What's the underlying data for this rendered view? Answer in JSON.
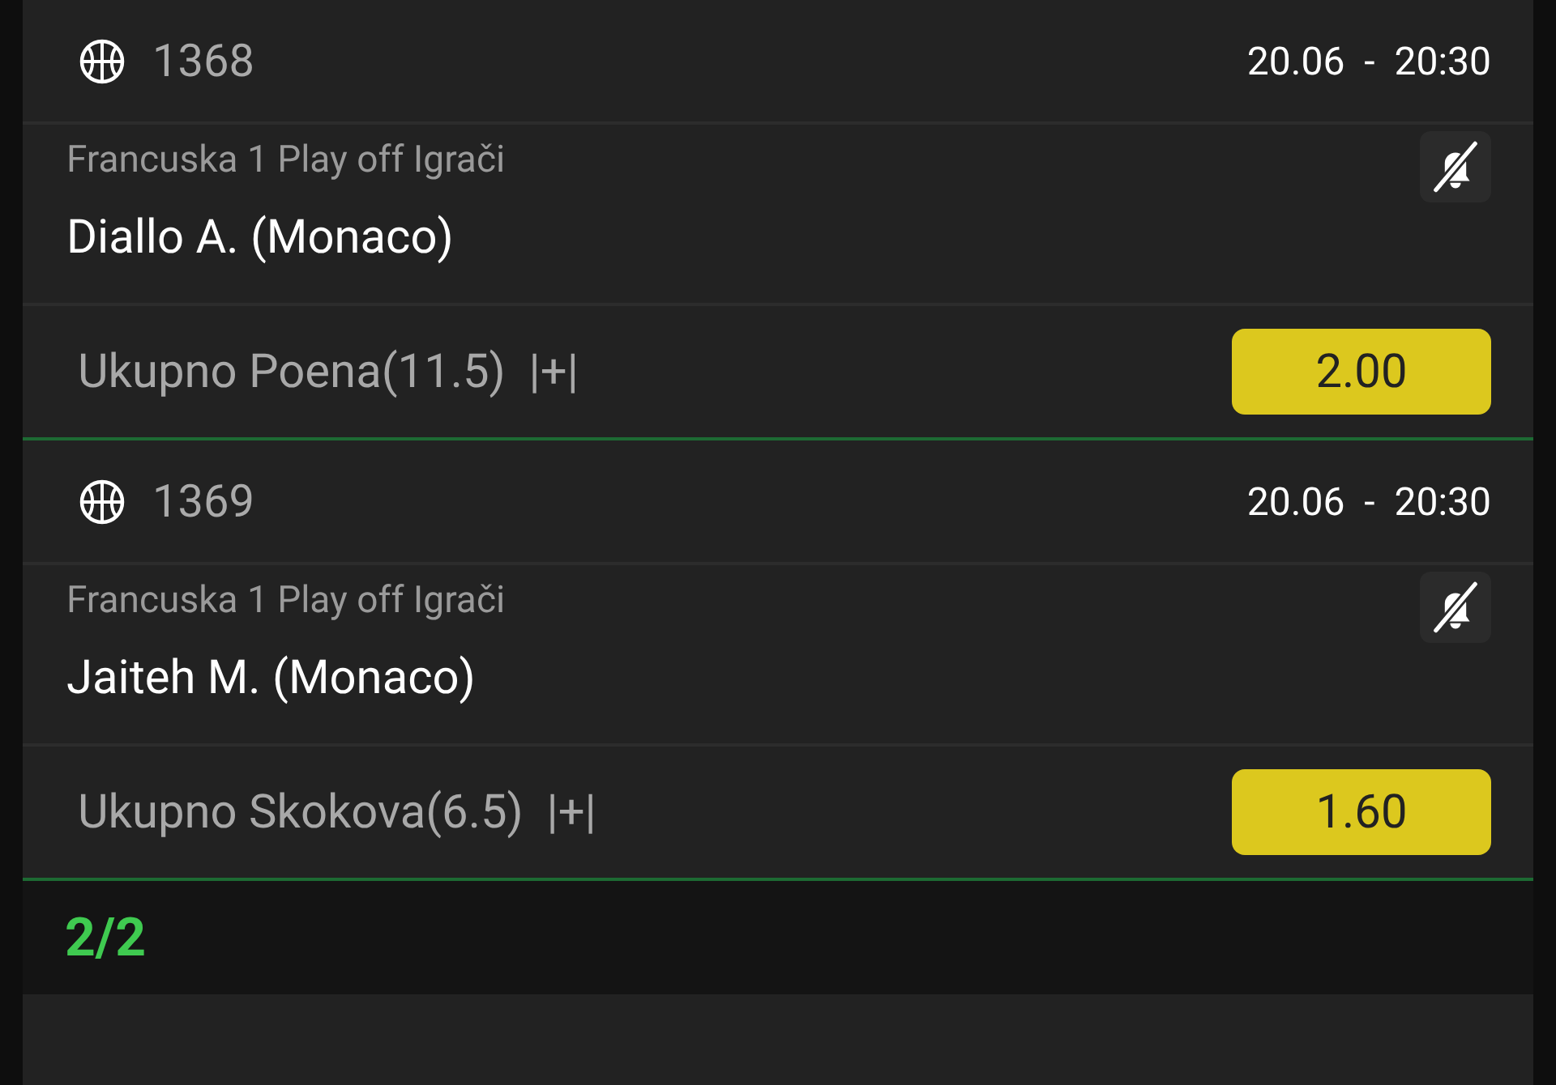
{
  "bets": [
    {
      "code": "1368",
      "datetime": "20.06 - 20:30",
      "league": "Francuska 1 Play off Igrači",
      "player": "Diallo A. (Monaco)",
      "market": "Ukupno Poena(11.5)  |+|",
      "odds": "2.00"
    },
    {
      "code": "1369",
      "datetime": "20.06 - 20:30",
      "league": "Francuska 1 Play off Igrači",
      "player": "Jaiteh M. (Monaco)",
      "market": "Ukupno Skokova(6.5)  |+|",
      "odds": "1.60"
    }
  ],
  "footer": {
    "count": "2/2"
  }
}
